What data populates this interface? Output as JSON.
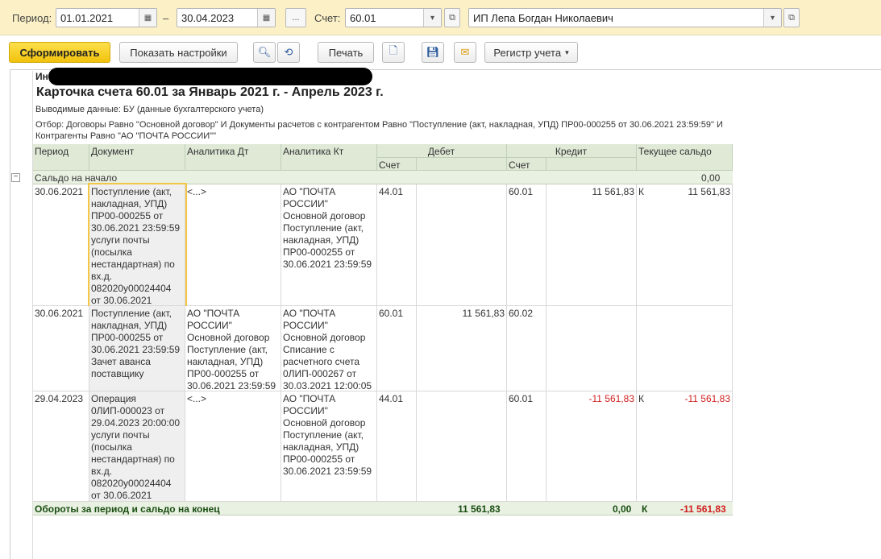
{
  "filters": {
    "period_label": "Период:",
    "date_from": "01.01.2021",
    "date_to": "30.04.2023",
    "dash": "–",
    "ellipsis": "...",
    "account_label": "Счет:",
    "account": "60.01",
    "org": "ИП Лепа Богдан Николаевич"
  },
  "toolbar": {
    "generate": "Сформировать",
    "show_settings": "Показать настройки",
    "print": "Печать",
    "register": "Регистр учета"
  },
  "report": {
    "org_prefix": "Ин",
    "title": "Карточка счета 60.01 за Январь 2021 г. - Апрель 2023 г.",
    "output_data": "Выводимые данные:  БУ (данные бухгалтерского учета)",
    "filter_line1": "Отбор:  Договоры Равно \"Основной договор\" И Документы расчетов с контрагентом Равно \"Поступление (акт, накладная, УПД) ПР00-000255 от 30.06.2021 23:59:59\" И",
    "filter_line2": "Контрагенты Равно \"АО \"ПОЧТА РОССИИ\"\"",
    "headers": {
      "period": "Период",
      "document": "Документ",
      "analytics_dt": "Аналитика Дт",
      "analytics_kt": "Аналитика Кт",
      "debit": "Дебет",
      "credit": "Кредит",
      "balance": "Текущее сальдо",
      "account": "Счет"
    },
    "opening": {
      "label": "Сальдо на начало",
      "value": "0,00"
    },
    "rows": [
      {
        "period": "30.06.2021",
        "document": "Поступление (акт, накладная, УПД) ПР00-000255 от 30.06.2021 23:59:59 услуги почты (посылка нестандартная) по вх.д. 082020y00024404 от 30.06.2021",
        "analytics_dt": "<...>",
        "analytics_kt": "АО \"ПОЧТА РОССИИ\" Основной договор Поступление (акт, накладная, УПД) ПР00-000255 от 30.06.2021 23:59:59",
        "debit_account": "44.01",
        "debit_amount": "",
        "credit_account": "60.01",
        "credit_amount": "11 561,83",
        "balance_side": "К",
        "balance": "11 561,83"
      },
      {
        "period": "30.06.2021",
        "document": "Поступление (акт, накладная, УПД) ПР00-000255 от 30.06.2021 23:59:59 Зачет аванса поставщику",
        "analytics_dt": "АО \"ПОЧТА РОССИИ\" Основной договор Поступление (акт, накладная, УПД) ПР00-000255 от 30.06.2021 23:59:59",
        "analytics_kt": "АО \"ПОЧТА РОССИИ\" Основной договор Списание с расчетного счета 0ЛИП-000267 от 30.03.2021 12:00:05",
        "debit_account": "60.01",
        "debit_amount": "11 561,83",
        "credit_account": "60.02",
        "credit_amount": "",
        "balance_side": "",
        "balance": ""
      },
      {
        "period": "29.04.2023",
        "document": "Операция 0ЛИП-000023 от 29.04.2023 20:00:00 услуги почты (посылка нестандартная) по вх.д. 082020y00024404 от 30.06.2021",
        "analytics_dt": "<...>",
        "analytics_kt": "АО \"ПОЧТА РОССИИ\" Основной договор Поступление (акт, накладная, УПД) ПР00-000255 от 30.06.2021 23:59:59",
        "debit_account": "44.01",
        "debit_amount": "",
        "credit_account": "60.01",
        "credit_amount": "-11 561,83",
        "balance_side": "К",
        "balance": "-11 561,83"
      }
    ],
    "totals": {
      "label": "Обороты за период и сальдо на конец",
      "debit": "11 561,83",
      "credit": "0,00",
      "side": "К",
      "balance": "-11 561,83"
    }
  },
  "colors": {
    "accent_button": "#f1c20c",
    "header_bg": "#dfe9d6",
    "negative": "#d01e1e",
    "filter_bar": "#fbf0c6"
  }
}
